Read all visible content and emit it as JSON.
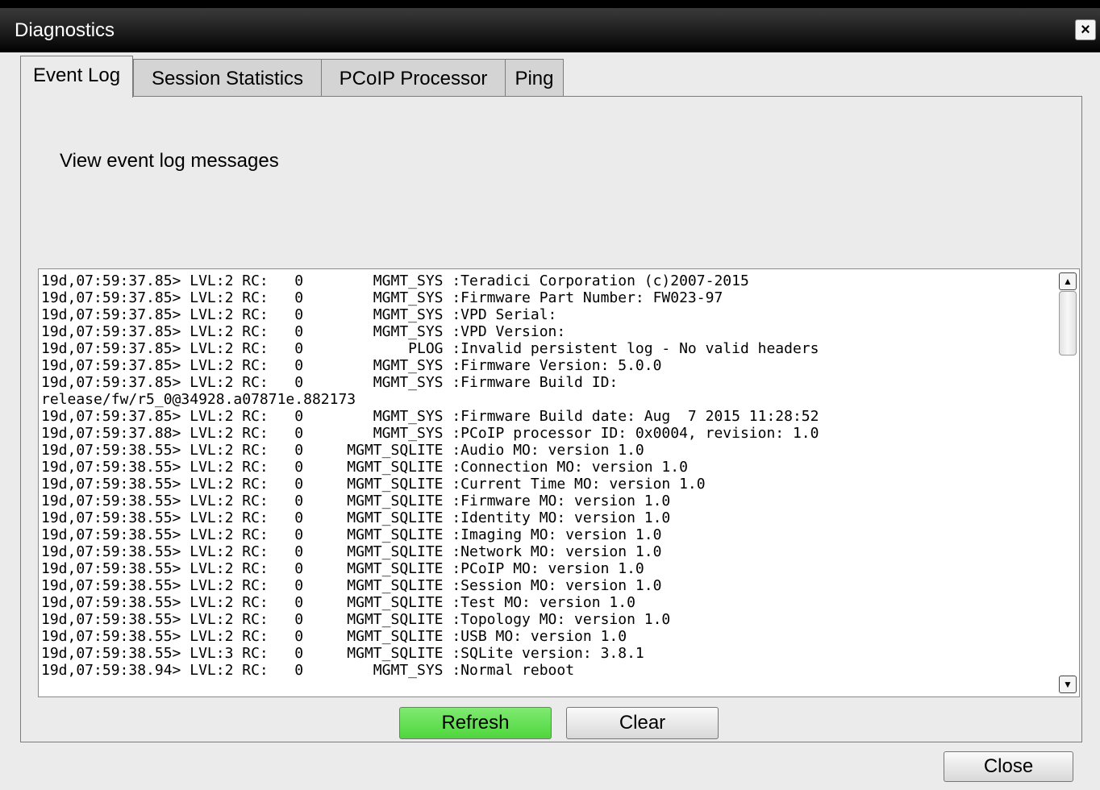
{
  "window": {
    "title": "Diagnostics",
    "close_glyph": "×"
  },
  "tabs": [
    {
      "label": "Event Log",
      "active": true
    },
    {
      "label": "Session Statistics",
      "active": false
    },
    {
      "label": "PCoIP Processor",
      "active": false
    },
    {
      "label": "Ping",
      "active": false
    }
  ],
  "event_log": {
    "description": "View event log messages",
    "log_text": "19d,07:59:37.85> LVL:2 RC:   0        MGMT_SYS :Teradici Corporation (c)2007-2015\n19d,07:59:37.85> LVL:2 RC:   0        MGMT_SYS :Firmware Part Number: FW023-97\n19d,07:59:37.85> LVL:2 RC:   0        MGMT_SYS :VPD Serial:\n19d,07:59:37.85> LVL:2 RC:   0        MGMT_SYS :VPD Version:\n19d,07:59:37.85> LVL:2 RC:   0            PLOG :Invalid persistent log - No valid headers\n19d,07:59:37.85> LVL:2 RC:   0        MGMT_SYS :Firmware Version: 5.0.0\n19d,07:59:37.85> LVL:2 RC:   0        MGMT_SYS :Firmware Build ID:\nrelease/fw/r5_0@34928.a07871e.882173\n19d,07:59:37.85> LVL:2 RC:   0        MGMT_SYS :Firmware Build date: Aug  7 2015 11:28:52\n19d,07:59:37.88> LVL:2 RC:   0        MGMT_SYS :PCoIP processor ID: 0x0004, revision: 1.0\n19d,07:59:38.55> LVL:2 RC:   0     MGMT_SQLITE :Audio MO: version 1.0\n19d,07:59:38.55> LVL:2 RC:   0     MGMT_SQLITE :Connection MO: version 1.0\n19d,07:59:38.55> LVL:2 RC:   0     MGMT_SQLITE :Current Time MO: version 1.0\n19d,07:59:38.55> LVL:2 RC:   0     MGMT_SQLITE :Firmware MO: version 1.0\n19d,07:59:38.55> LVL:2 RC:   0     MGMT_SQLITE :Identity MO: version 1.0\n19d,07:59:38.55> LVL:2 RC:   0     MGMT_SQLITE :Imaging MO: version 1.0\n19d,07:59:38.55> LVL:2 RC:   0     MGMT_SQLITE :Network MO: version 1.0\n19d,07:59:38.55> LVL:2 RC:   0     MGMT_SQLITE :PCoIP MO: version 1.0\n19d,07:59:38.55> LVL:2 RC:   0     MGMT_SQLITE :Session MO: version 1.0\n19d,07:59:38.55> LVL:2 RC:   0     MGMT_SQLITE :Test MO: version 1.0\n19d,07:59:38.55> LVL:2 RC:   0     MGMT_SQLITE :Topology MO: version 1.0\n19d,07:59:38.55> LVL:2 RC:   0     MGMT_SQLITE :USB MO: version 1.0\n19d,07:59:38.55> LVL:3 RC:   0     MGMT_SQLITE :SQLite version: 3.8.1\n19d,07:59:38.94> LVL:2 RC:   0        MGMT_SYS :Normal reboot",
    "scroll_up_glyph": "▲",
    "scroll_down_glyph": "▼",
    "refresh_label": "Refresh",
    "clear_label": "Clear"
  },
  "footer": {
    "close_label": "Close"
  },
  "colors": {
    "refresh_button": "#5ddc4a",
    "titlebar": "#000000",
    "background": "#ebebeb"
  }
}
